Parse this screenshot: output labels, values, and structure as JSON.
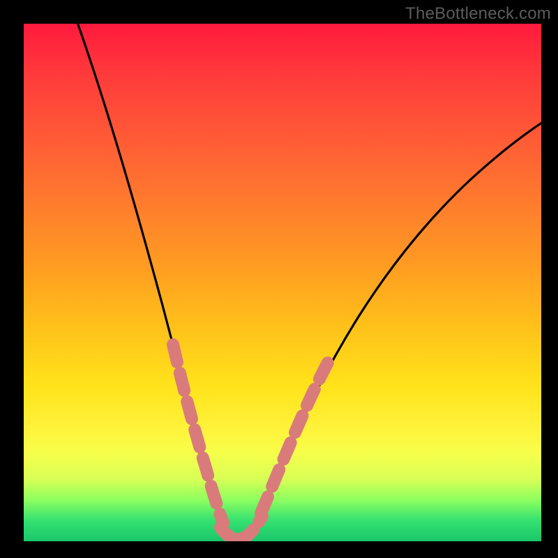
{
  "watermark": "TheBottleneck.com",
  "colors": {
    "frame": "#000000",
    "curve": "#000000",
    "highlight": "#d97b7b",
    "gradient_stops": [
      "#ff1a3d",
      "#ff3b3b",
      "#ff5a36",
      "#ff7a2e",
      "#ff9a22",
      "#ffbf1a",
      "#ffe31a",
      "#fff23a",
      "#f6ff4a",
      "#d8ff55",
      "#8dff60",
      "#35e170",
      "#19c76a"
    ]
  },
  "chart_data": {
    "type": "line",
    "title": "",
    "xlabel": "",
    "ylabel": "",
    "xlim": [
      0,
      100
    ],
    "ylim": [
      0,
      100
    ],
    "grid": false,
    "series": [
      {
        "name": "bottleneck-curve",
        "x": [
          10,
          14,
          18,
          22,
          25,
          27,
          29,
          30.5,
          32,
          33.5,
          35,
          37,
          38.5,
          40,
          42,
          45,
          50,
          55,
          60,
          65,
          72,
          80,
          88,
          96,
          100
        ],
        "y": [
          100,
          88,
          75,
          62,
          52,
          45,
          37,
          30,
          22,
          14,
          7,
          2,
          0.5,
          0.5,
          2,
          6,
          13,
          21,
          28,
          35,
          44,
          53,
          61,
          68,
          72
        ]
      }
    ],
    "highlight_segments": [
      {
        "name": "left-approach",
        "x_range": [
          27,
          35
        ],
        "note": "pink dotted overlay descending toward minimum"
      },
      {
        "name": "trough",
        "x_range": [
          35,
          43
        ],
        "note": "pink dotted overlay across minimum"
      },
      {
        "name": "right-approach",
        "x_range": [
          43,
          52
        ],
        "note": "pink dotted overlay ascending from minimum"
      }
    ],
    "minimum": {
      "x": 39,
      "y": 0.5
    }
  }
}
